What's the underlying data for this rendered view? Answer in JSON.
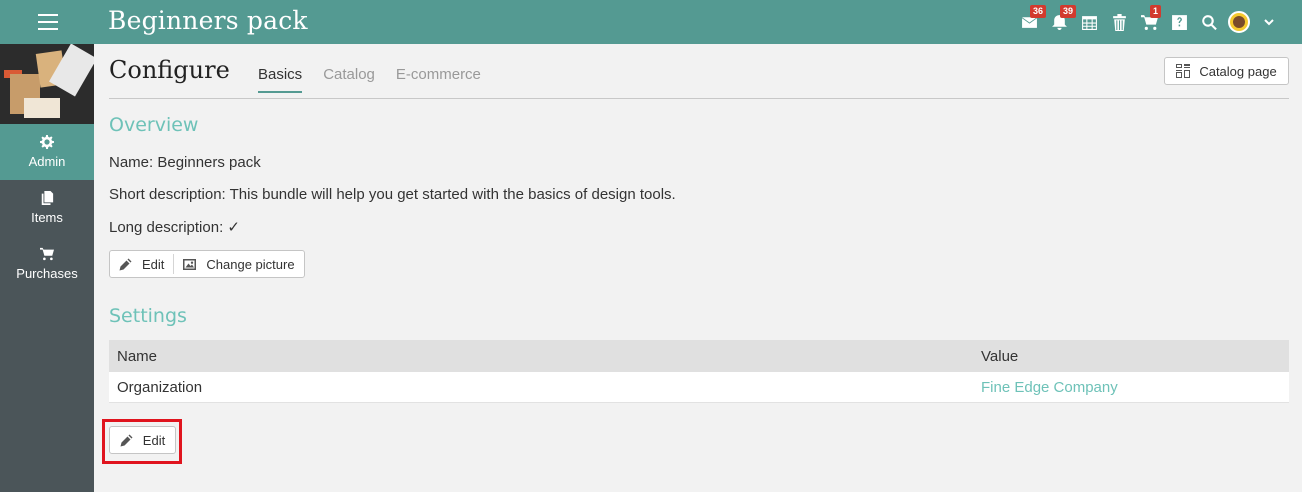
{
  "header": {
    "title": "Beginners pack",
    "badges": {
      "messages": "36",
      "notifications": "39",
      "cart": "1"
    }
  },
  "sidebar": {
    "items": [
      {
        "label": "Admin",
        "icon": "gear-icon",
        "active": true
      },
      {
        "label": "Items",
        "icon": "files-icon",
        "active": false
      },
      {
        "label": "Purchases",
        "icon": "cart-icon",
        "active": false
      }
    ]
  },
  "main": {
    "page_title": "Configure",
    "tabs": [
      {
        "label": "Basics",
        "active": true
      },
      {
        "label": "Catalog",
        "active": false
      },
      {
        "label": "E-commerce",
        "active": false
      }
    ],
    "catalog_button": "Catalog page",
    "overview": {
      "heading": "Overview",
      "name": "Name: Beginners pack",
      "short_description": "Short description: This bundle will help you get started with the basics of design tools.",
      "long_description": "Long description: ✓",
      "edit_label": "Edit",
      "change_picture_label": "Change picture"
    },
    "settings": {
      "heading": "Settings",
      "columns": {
        "name": "Name",
        "value": "Value"
      },
      "rows": [
        {
          "name": "Organization",
          "value": "Fine Edge Company"
        }
      ],
      "edit_label": "Edit"
    }
  },
  "colors": {
    "accent": "#549a92",
    "heading": "#6ec2b8",
    "sidebar": "#4b5559",
    "badge": "#d23a2e",
    "highlight": "#e0141e"
  }
}
